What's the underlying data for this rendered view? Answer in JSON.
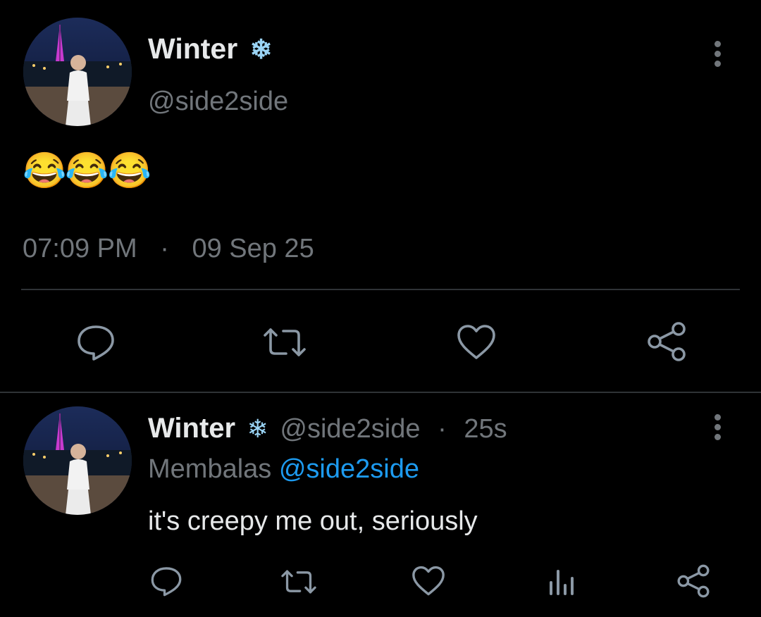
{
  "main_tweet": {
    "author_name": "Winter",
    "name_emoji": "❄",
    "handle": "@side2side",
    "content_emoji": "😂😂😂",
    "time": "07:09 PM",
    "separator": "·",
    "date": "09 Sep 25",
    "actions": [
      "reply-icon",
      "retweet-icon",
      "like-icon",
      "share-icon"
    ]
  },
  "reply": {
    "author_name": "Winter",
    "name_emoji": "❄",
    "handle": "@side2side",
    "separator": "·",
    "time_ago": "25s",
    "replying_label": "Membalas",
    "replying_to": "@side2side",
    "text": "it's creepy me out, seriously",
    "actions": [
      "reply-icon",
      "retweet-icon",
      "like-icon",
      "views-icon",
      "share-icon"
    ]
  },
  "colors": {
    "background": "#000000",
    "text": "#e7e9ea",
    "muted": "#71767b",
    "link": "#1d9bf0",
    "divider": "#2f3336",
    "snowflake": "#9ad4f5"
  }
}
